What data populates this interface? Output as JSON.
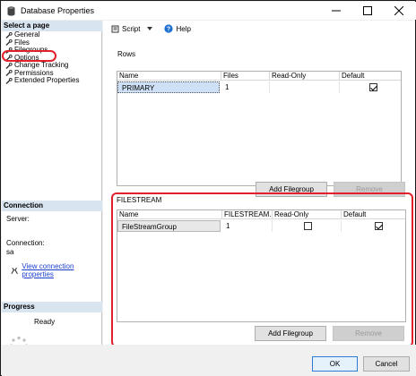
{
  "window": {
    "title": "Database Properties",
    "icon": "database-icon",
    "controls": [
      "minimize",
      "maximize",
      "close"
    ]
  },
  "left_pane": {
    "select_page_header": "Select a page",
    "pages": [
      {
        "label": "General",
        "selected": false
      },
      {
        "label": "Files",
        "selected": false
      },
      {
        "label": "Filegroups",
        "selected": true
      },
      {
        "label": "Options",
        "selected": false
      },
      {
        "label": "Change Tracking",
        "selected": false
      },
      {
        "label": "Permissions",
        "selected": false
      },
      {
        "label": "Extended Properties",
        "selected": false
      }
    ],
    "connection_header": "Connection",
    "server_label": "Server:",
    "server_value": "",
    "connection_label": "Connection:",
    "connection_value": "sa",
    "view_connection_link": "View connection properties",
    "progress_header": "Progress",
    "progress_status": "Ready"
  },
  "toolbar": {
    "script_label": "Script",
    "help_label": "Help"
  },
  "rows_section": {
    "title": "Rows",
    "columns": [
      "Name",
      "Files",
      "Read-Only",
      "Default"
    ],
    "rows": [
      {
        "name": "PRIMARY",
        "files": "1",
        "read_only": false,
        "default": true
      }
    ],
    "add_button": "Add Filegroup",
    "remove_button": "Remove"
  },
  "filestream_section": {
    "title": "FILESTREAM",
    "columns": [
      "Name",
      "FILESTREAM...",
      "Read-Only",
      "Default"
    ],
    "rows": [
      {
        "name": "FileStreamGroup",
        "files": "1",
        "read_only": false,
        "default": true
      }
    ],
    "add_button": "Add Filegroup",
    "remove_button": "Remove"
  },
  "footer": {
    "ok_button": "OK",
    "cancel_button": "Cancel"
  },
  "colors": {
    "highlight_ring": "#e0202a",
    "section_header_bg": "#d9e4f1",
    "link": "#1a3fcf",
    "selected_cell_bg": "#cde0f5"
  }
}
